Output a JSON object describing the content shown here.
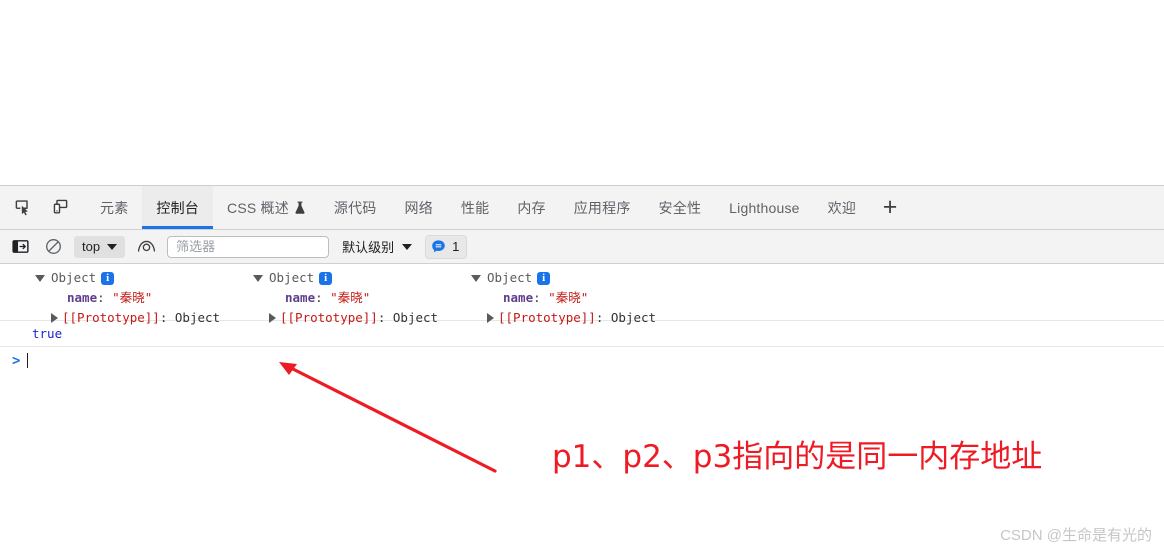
{
  "tabbar": {
    "inspect_icon": "inspect-element-icon",
    "device_icon": "device-toolbar-icon",
    "tabs": [
      {
        "label": "元素",
        "active": false,
        "icon": null
      },
      {
        "label": "控制台",
        "active": true,
        "icon": null
      },
      {
        "label": "CSS 概述",
        "active": false,
        "icon": "flask-icon"
      },
      {
        "label": "源代码",
        "active": false,
        "icon": null
      },
      {
        "label": "网络",
        "active": false,
        "icon": null
      },
      {
        "label": "性能",
        "active": false,
        "icon": null
      },
      {
        "label": "内存",
        "active": false,
        "icon": null
      },
      {
        "label": "应用程序",
        "active": false,
        "icon": null
      },
      {
        "label": "安全性",
        "active": false,
        "icon": null
      },
      {
        "label": "Lighthouse",
        "active": false,
        "icon": null
      },
      {
        "label": "欢迎",
        "active": false,
        "icon": null
      }
    ],
    "add_tab_label": "+"
  },
  "console_toolbar": {
    "sidebar_toggle_icon": "console-sidebar-icon",
    "clear_icon": "clear-console-icon",
    "context_value": "top",
    "eye_icon": "live-expression-icon",
    "filter_placeholder": "筛选器",
    "filter_value": "",
    "level_label": "默认级别",
    "message_count": "1",
    "message_icon": "info-message-icon"
  },
  "console_output": {
    "objects": [
      {
        "header": "Object",
        "badge": "i",
        "property_key": "name",
        "property_value": "\"秦晓\"",
        "proto_key": "[[Prototype]]",
        "proto_value": "Object"
      },
      {
        "header": "Object",
        "badge": "i",
        "property_key": "name",
        "property_value": "\"秦晓\"",
        "proto_key": "[[Prototype]]",
        "proto_value": "Object"
      },
      {
        "header": "Object",
        "badge": "i",
        "property_key": "name",
        "property_value": "\"秦晓\"",
        "proto_key": "[[Prototype]]",
        "proto_value": "Object"
      }
    ],
    "result": "true",
    "prompt_symbol": ">",
    "prompt_value": ""
  },
  "annotation": {
    "text": "p1、p2、p3指向的是同一内存地址",
    "color": "#ee1b24",
    "arrow_name": "red-annotation-arrow"
  },
  "watermark": {
    "text": "CSDN @生命是有光的"
  },
  "colors": {
    "accent": "#1a73e8",
    "annotation_red": "#ee1b24",
    "toolbar_bg": "#f3f3f3",
    "active_tab_bg": "#ececec"
  }
}
